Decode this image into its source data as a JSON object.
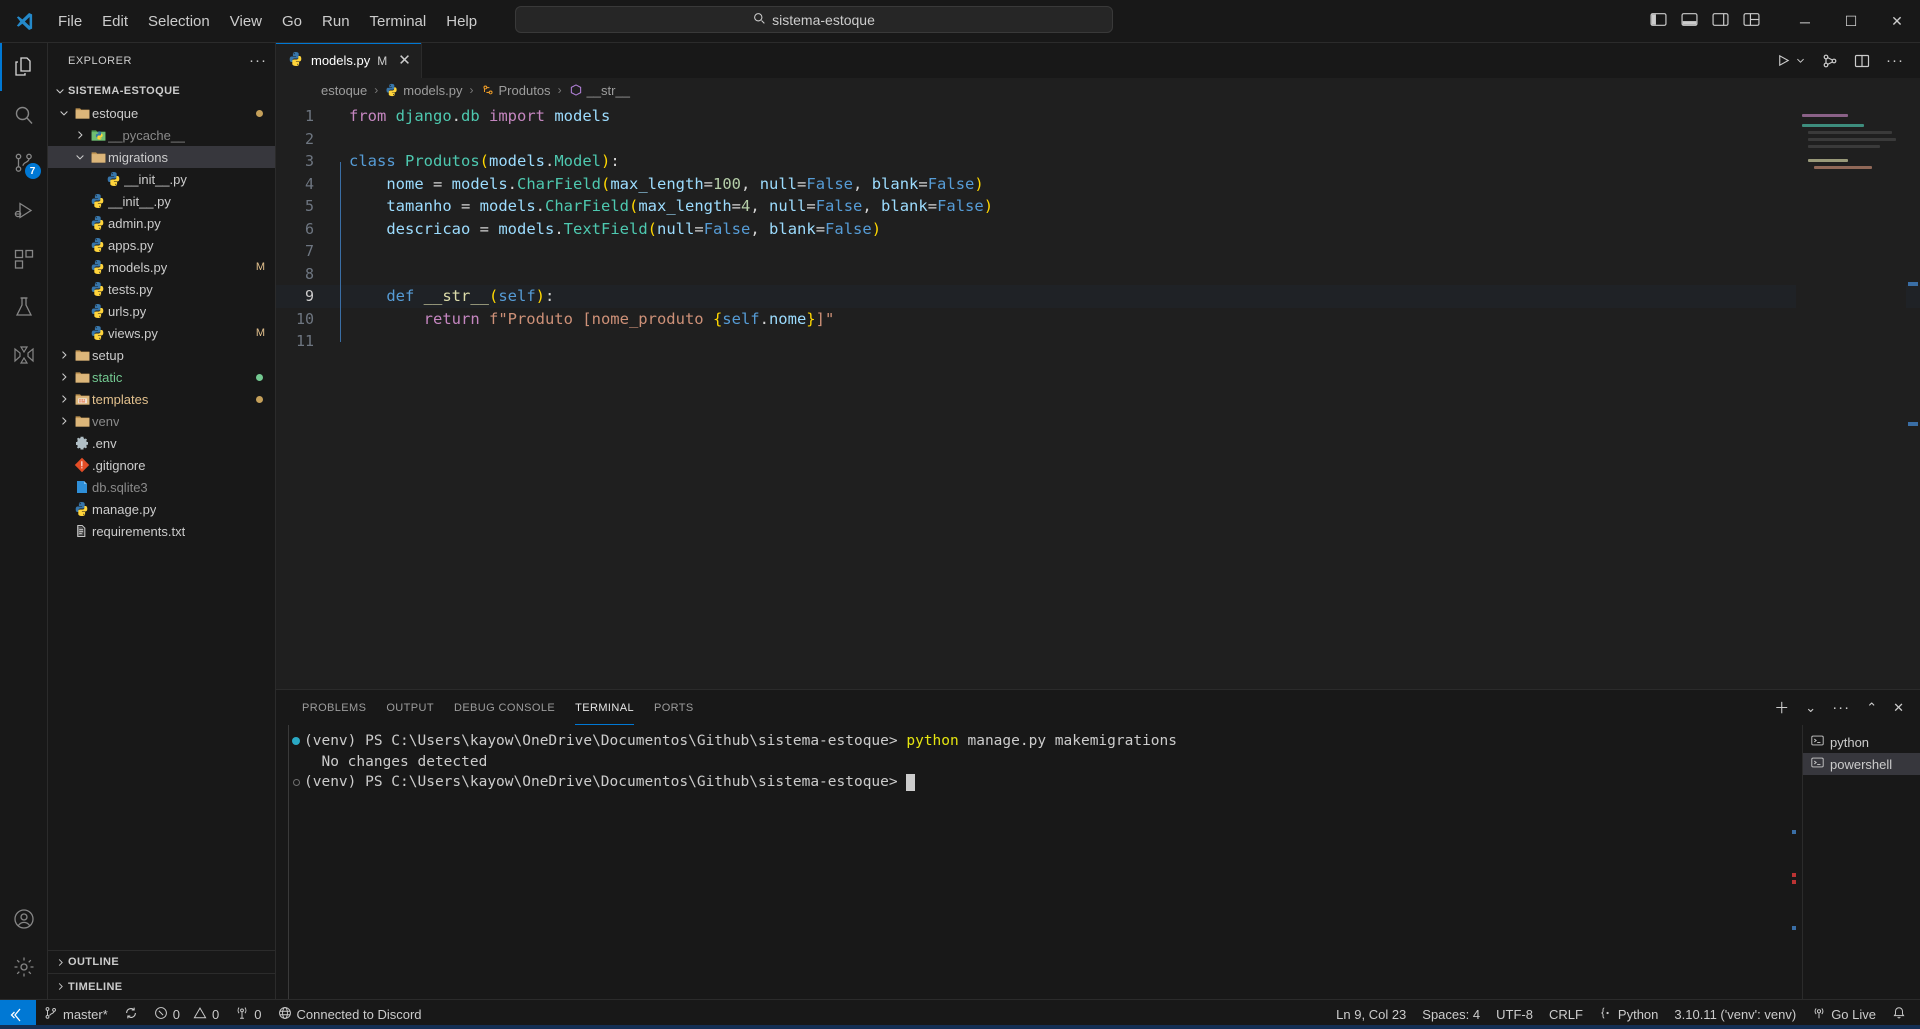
{
  "titlebar": {
    "menu": [
      "File",
      "Edit",
      "Selection",
      "View",
      "Go",
      "Run",
      "Terminal",
      "Help"
    ],
    "back_arrow": "←",
    "forward_arrow": "→",
    "command_center_text": "sistema-estoque",
    "window_minimize": "─",
    "window_maximize": "☐",
    "window_close": "✕"
  },
  "activitybar": {
    "items": [
      {
        "name": "explorer",
        "active": true
      },
      {
        "name": "search",
        "active": false
      },
      {
        "name": "source-control",
        "active": false,
        "badge": "7"
      },
      {
        "name": "run-and-debug",
        "active": false
      },
      {
        "name": "extensions",
        "active": false
      },
      {
        "name": "testing",
        "active": false
      },
      {
        "name": "azure",
        "active": false
      }
    ],
    "bottom": [
      {
        "name": "accounts"
      },
      {
        "name": "settings"
      }
    ]
  },
  "sidebar": {
    "title": "EXPLORER",
    "more_actions": "···",
    "tree": [
      {
        "label": "SISTEMA-ESTOQUE",
        "depth": 0,
        "type": "root",
        "expanded": true
      },
      {
        "label": "estoque",
        "depth": 1,
        "type": "folder",
        "expanded": true,
        "decor_dot": "#c5a05a"
      },
      {
        "label": "__pycache__",
        "depth": 2,
        "type": "folder-python",
        "expanded": false,
        "dim": true
      },
      {
        "label": "migrations",
        "depth": 2,
        "type": "folder",
        "expanded": true,
        "selected": true
      },
      {
        "label": "__init__.py",
        "depth": 3,
        "type": "python"
      },
      {
        "label": "__init__.py",
        "depth": 2,
        "type": "python"
      },
      {
        "label": "admin.py",
        "depth": 2,
        "type": "python"
      },
      {
        "label": "apps.py",
        "depth": 2,
        "type": "python"
      },
      {
        "label": "models.py",
        "depth": 2,
        "type": "python",
        "decor": "M",
        "decor_color": "#e2c08d"
      },
      {
        "label": "tests.py",
        "depth": 2,
        "type": "python"
      },
      {
        "label": "urls.py",
        "depth": 2,
        "type": "python"
      },
      {
        "label": "views.py",
        "depth": 2,
        "type": "python",
        "decor": "M",
        "decor_color": "#e2c08d"
      },
      {
        "label": "setup",
        "depth": 1,
        "type": "folder",
        "expanded": false
      },
      {
        "label": "static",
        "depth": 1,
        "type": "folder",
        "expanded": false,
        "color": "#73c991",
        "decor_dot": "#73c991"
      },
      {
        "label": "templates",
        "depth": 1,
        "type": "folder-html",
        "expanded": false,
        "color": "#e2c08d",
        "decor_dot": "#c5a05a"
      },
      {
        "label": "venv",
        "depth": 1,
        "type": "folder",
        "expanded": false,
        "dim": true
      },
      {
        "label": ".env",
        "depth": 1,
        "type": "gear"
      },
      {
        "label": ".gitignore",
        "depth": 1,
        "type": "git"
      },
      {
        "label": "db.sqlite3",
        "depth": 1,
        "type": "database",
        "dim": true
      },
      {
        "label": "manage.py",
        "depth": 1,
        "type": "python"
      },
      {
        "label": "requirements.txt",
        "depth": 1,
        "type": "text"
      }
    ],
    "sections": [
      {
        "label": "OUTLINE"
      },
      {
        "label": "TIMELINE"
      }
    ]
  },
  "editor": {
    "tab": {
      "label": "models.py",
      "dirty_indicator": "M",
      "close": "✕"
    },
    "actions": {
      "run": "▷",
      "run_chevron": "⌄",
      "split_editor": "◫",
      "more": "···",
      "source_control_graph": "⎇"
    },
    "breadcrumbs": [
      "estoque",
      "models.py",
      "Produtos",
      "__str__"
    ],
    "lines": [
      {
        "n": "1",
        "tokens": [
          [
            "t-kw",
            "from "
          ],
          [
            "t-cls",
            "django"
          ],
          [
            "t-plain",
            "."
          ],
          [
            "t-cls",
            "db"
          ],
          [
            "t-kw",
            " import "
          ],
          [
            "t-var",
            "models"
          ]
        ]
      },
      {
        "n": "2",
        "tokens": []
      },
      {
        "n": "3",
        "tokens": [
          [
            "t-kw2",
            "class "
          ],
          [
            "t-cls",
            "Produtos"
          ],
          [
            "t-par",
            "("
          ],
          [
            "t-var",
            "models"
          ],
          [
            "t-plain",
            "."
          ],
          [
            "t-cls",
            "Model"
          ],
          [
            "t-par",
            ")"
          ],
          [
            "t-plain",
            ":"
          ]
        ]
      },
      {
        "n": "4",
        "tokens": [
          [
            "t-plain",
            "    "
          ],
          [
            "t-var",
            "nome"
          ],
          [
            "t-plain",
            " = "
          ],
          [
            "t-var",
            "models"
          ],
          [
            "t-plain",
            "."
          ],
          [
            "t-cls",
            "CharField"
          ],
          [
            "t-par",
            "("
          ],
          [
            "t-var",
            "max_length"
          ],
          [
            "t-plain",
            "="
          ],
          [
            "t-num",
            "100"
          ],
          [
            "t-plain",
            ", "
          ],
          [
            "t-var",
            "null"
          ],
          [
            "t-plain",
            "="
          ],
          [
            "t-kw2",
            "False"
          ],
          [
            "t-plain",
            ", "
          ],
          [
            "t-var",
            "blank"
          ],
          [
            "t-plain",
            "="
          ],
          [
            "t-kw2",
            "False"
          ],
          [
            "t-par",
            ")"
          ]
        ]
      },
      {
        "n": "5",
        "tokens": [
          [
            "t-plain",
            "    "
          ],
          [
            "t-var",
            "tamanho"
          ],
          [
            "t-plain",
            " = "
          ],
          [
            "t-var",
            "models"
          ],
          [
            "t-plain",
            "."
          ],
          [
            "t-cls",
            "CharField"
          ],
          [
            "t-par",
            "("
          ],
          [
            "t-var",
            "max_length"
          ],
          [
            "t-plain",
            "="
          ],
          [
            "t-num",
            "4"
          ],
          [
            "t-plain",
            ", "
          ],
          [
            "t-var",
            "null"
          ],
          [
            "t-plain",
            "="
          ],
          [
            "t-kw2",
            "False"
          ],
          [
            "t-plain",
            ", "
          ],
          [
            "t-var",
            "blank"
          ],
          [
            "t-plain",
            "="
          ],
          [
            "t-kw2",
            "False"
          ],
          [
            "t-par",
            ")"
          ]
        ]
      },
      {
        "n": "6",
        "tokens": [
          [
            "t-plain",
            "    "
          ],
          [
            "t-var",
            "descricao"
          ],
          [
            "t-plain",
            " = "
          ],
          [
            "t-var",
            "models"
          ],
          [
            "t-plain",
            "."
          ],
          [
            "t-cls",
            "TextField"
          ],
          [
            "t-par",
            "("
          ],
          [
            "t-var",
            "null"
          ],
          [
            "t-plain",
            "="
          ],
          [
            "t-kw2",
            "False"
          ],
          [
            "t-plain",
            ", "
          ],
          [
            "t-var",
            "blank"
          ],
          [
            "t-plain",
            "="
          ],
          [
            "t-kw2",
            "False"
          ],
          [
            "t-par",
            ")"
          ]
        ]
      },
      {
        "n": "7",
        "tokens": []
      },
      {
        "n": "8",
        "tokens": []
      },
      {
        "n": "9",
        "highlight": true,
        "tokens": [
          [
            "t-plain",
            "    "
          ],
          [
            "t-kw2",
            "def "
          ],
          [
            "t-fn",
            "__str__"
          ],
          [
            "t-par",
            "("
          ],
          [
            "t-self",
            "self"
          ],
          [
            "t-par",
            ")"
          ],
          [
            "t-plain",
            ":"
          ]
        ]
      },
      {
        "n": "10",
        "tokens": [
          [
            "t-plain",
            "        "
          ],
          [
            "t-kw",
            "return "
          ],
          [
            "t-str",
            "f\"Produto [nome_produto "
          ],
          [
            "t-par",
            "{"
          ],
          [
            "t-self",
            "self"
          ],
          [
            "t-plain",
            "."
          ],
          [
            "t-var",
            "nome"
          ],
          [
            "t-par",
            "}"
          ],
          [
            "t-str",
            "]\""
          ]
        ]
      },
      {
        "n": "11",
        "tokens": []
      }
    ]
  },
  "panel": {
    "tabs": [
      "PROBLEMS",
      "OUTPUT",
      "DEBUG CONSOLE",
      "TERMINAL",
      "PORTS"
    ],
    "active_tab": "TERMINAL",
    "actions": {
      "new_terminal": "＋",
      "dropdown": "⌄",
      "more": "···",
      "maximize": "⌃",
      "close": "✕"
    },
    "terminal_lines": [
      {
        "mark": "fill",
        "segments": [
          [
            "",
            "(venv) PS C:\\Users\\kayow\\OneDrive\\Documentos\\Github\\sistema-estoque> "
          ],
          [
            "t-yellow",
            "python"
          ],
          [
            "",
            " manage.py makemigrations"
          ]
        ]
      },
      {
        "mark": "none",
        "segments": [
          [
            "",
            "  No changes detected"
          ]
        ]
      },
      {
        "mark": "hollow",
        "segments": [
          [
            "",
            "(venv) PS C:\\Users\\kayow\\OneDrive\\Documentos\\Github\\sistema-estoque> "
          ]
        ],
        "cursor": true
      }
    ],
    "side_items": [
      {
        "label": "python",
        "active": false
      },
      {
        "label": "powershell",
        "active": true
      }
    ]
  },
  "statusbar": {
    "remote_icon": "remote-window-icon",
    "left": [
      {
        "name": "branch",
        "label": "master*"
      },
      {
        "name": "sync",
        "label": ""
      },
      {
        "name": "errors",
        "label": "0"
      },
      {
        "name": "warnings",
        "label": "0"
      },
      {
        "name": "ports",
        "label": "0"
      },
      {
        "name": "discord",
        "label": "Connected to Discord"
      }
    ],
    "right": [
      {
        "name": "cursor-position",
        "label": "Ln 9, Col 23"
      },
      {
        "name": "indentation",
        "label": "Spaces: 4"
      },
      {
        "name": "encoding",
        "label": "UTF-8"
      },
      {
        "name": "eol",
        "label": "CRLF"
      },
      {
        "name": "language-mode",
        "label": "Python"
      },
      {
        "name": "python-interpreter",
        "label": "3.10.11 ('venv': venv)"
      },
      {
        "name": "go-live",
        "label": "Go Live"
      },
      {
        "name": "notifications",
        "label": ""
      }
    ]
  },
  "colors": {
    "accent": "#0078d4",
    "modified": "#e2c08d",
    "added": "#73c991",
    "bg": "#1f1f1f",
    "chrome": "#181818"
  }
}
